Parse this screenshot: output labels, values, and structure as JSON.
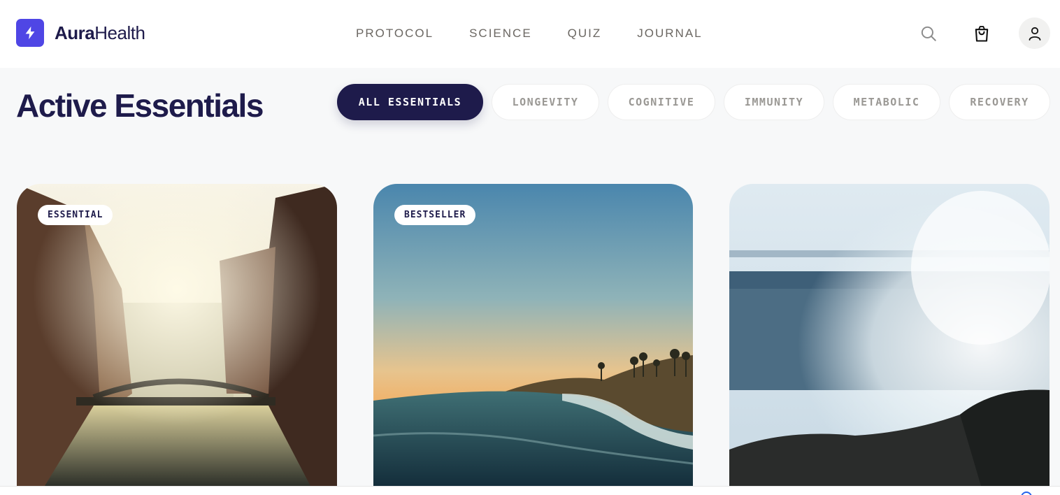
{
  "brand": {
    "name_strong": "Aura",
    "name_light": "Health",
    "accent": "#4f46e5",
    "ink": "#1e1b4b"
  },
  "nav": {
    "items": [
      "PROTOCOL",
      "SCIENCE",
      "QUIZ",
      "JOURNAL"
    ]
  },
  "header_icons": [
    "search-icon",
    "shopping-bag-icon",
    "user-icon"
  ],
  "page": {
    "title": "Active Essentials"
  },
  "filters": {
    "items": [
      "ALL ESSENTIALS",
      "LONGEVITY",
      "COGNITIVE",
      "IMMUNITY",
      "METABOLIC",
      "RECOVERY"
    ],
    "active": "ALL ESSENTIALS"
  },
  "products": [
    {
      "badge": "ESSENTIAL",
      "image": "sunlit canal between brick warehouses with bridge"
    },
    {
      "badge": "BESTSELLER",
      "image": "ocean wave at sunset with palm-lined cliffs"
    },
    {
      "badge": "",
      "image": "wave crashing on rocks"
    }
  ]
}
